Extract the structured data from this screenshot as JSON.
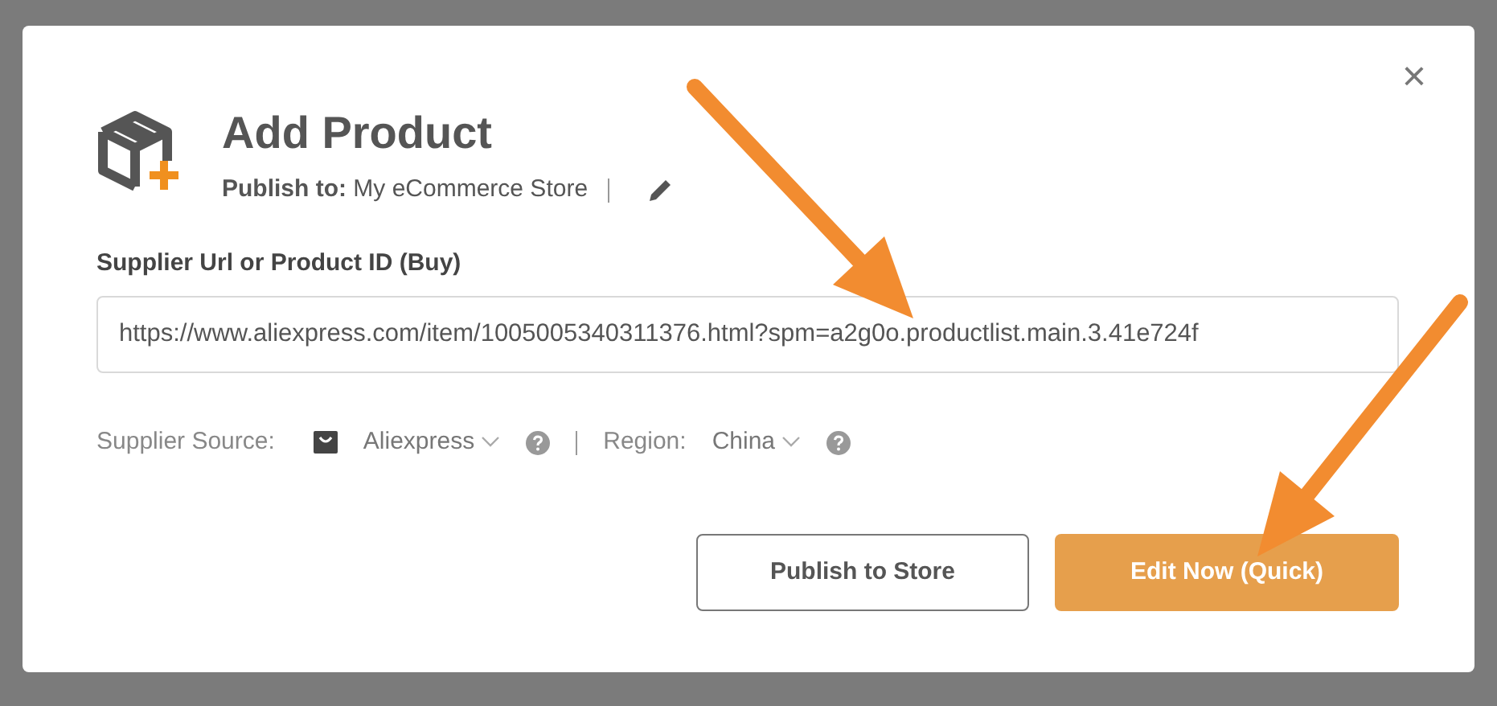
{
  "dialog": {
    "title": "Add Product",
    "publish_to": {
      "label": "Publish to:",
      "value": "My eCommerce Store"
    },
    "url_field": {
      "label": "Supplier Url or Product ID (Buy)",
      "value": "https://www.aliexpress.com/item/1005005340311376.html?spm=a2g0o.productlist.main.3.41e724f"
    },
    "supplier_source": {
      "label": "Supplier Source:",
      "value": "Aliexpress"
    },
    "region": {
      "label": "Region:",
      "value": "China"
    },
    "buttons": [
      {
        "label": "Publish to Store",
        "kind": "outline"
      },
      {
        "label": "Edit Now (Quick)",
        "kind": "primary"
      }
    ],
    "close": "×"
  }
}
